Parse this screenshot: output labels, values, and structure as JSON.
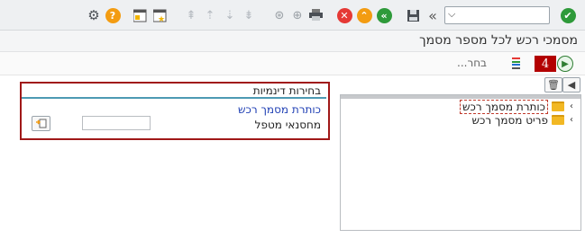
{
  "toolbar": {
    "command_field_value": "",
    "icons": [
      "check-icon",
      "dropdown-icon",
      "fast-forward-icon",
      "save-icon",
      "back-icon",
      "exit-icon",
      "cancel-icon",
      "print-icon",
      "find-icon",
      "find-next-icon",
      "first-page-icon",
      "previous-page-icon",
      "next-page-icon",
      "last-page-icon",
      "new-session-icon",
      "shortcut-icon",
      "help-icon",
      "settings-icon"
    ],
    "colors": {
      "green": "#2e9a3a",
      "orange": "#f39c12",
      "red": "#e53935"
    }
  },
  "title": "מסמכי רכש לכל מספר מסמך",
  "app_toolbar": {
    "choose_label": "בחר...",
    "badge_number": "4",
    "execute_icon": "execute-icon",
    "columns_icon": "select-columns-icon"
  },
  "dynamic_selections": {
    "header": "בחירות דינמיות",
    "subtitle": "כותרת מסמך רכש",
    "field_label": "מחסנאי מטפל",
    "field_value": ""
  },
  "tree": {
    "items": [
      {
        "label": "כותרת מסמך רכש",
        "selected": true
      },
      {
        "label": "פריט מסמך רכש",
        "selected": false
      }
    ]
  }
}
